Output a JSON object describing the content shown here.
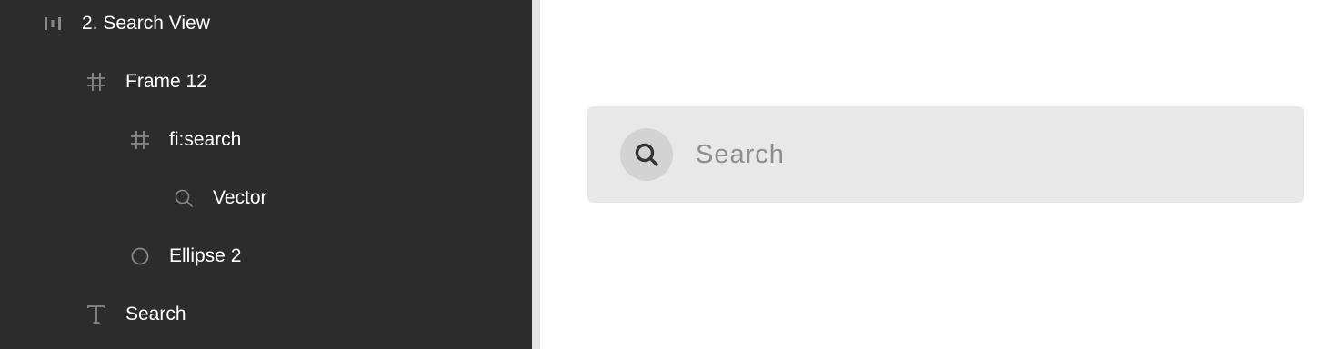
{
  "layers": [
    {
      "id": "search-view",
      "label": "2. Search View",
      "icon": "component-icon",
      "depth": 0
    },
    {
      "id": "frame-12",
      "label": "Frame 12",
      "icon": "frame-icon",
      "depth": 1
    },
    {
      "id": "fi-search",
      "label": "fi:search",
      "icon": "frame-icon",
      "depth": 2
    },
    {
      "id": "vector",
      "label": "Vector",
      "icon": "vector-search-icon",
      "depth": 3
    },
    {
      "id": "ellipse-2",
      "label": "Ellipse 2",
      "icon": "ellipse-icon",
      "depth": 2
    },
    {
      "id": "search-text",
      "label": "Search",
      "icon": "text-icon",
      "depth": 1
    }
  ],
  "canvas": {
    "search_placeholder": "Search",
    "search_icon": "search-icon"
  },
  "colors": {
    "panel_background": "#2c2c2c",
    "panel_text": "#ffffff",
    "layer_icon": "#8a8a8a",
    "search_bar_background": "#e8e8e8",
    "search_icon_circle": "#d3d3d3",
    "search_icon_stroke": "#333333",
    "placeholder_text": "#8e8e8e"
  }
}
